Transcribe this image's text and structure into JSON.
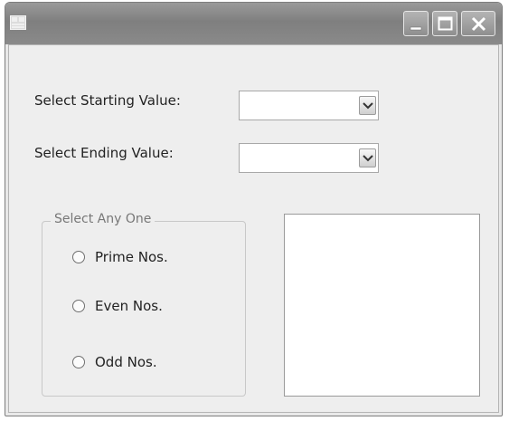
{
  "window": {
    "icon": "form-app-icon",
    "controls": [
      "minimize-icon",
      "maximize-icon",
      "close-icon"
    ]
  },
  "form": {
    "start_label": "Select Starting Value:",
    "start_value": "",
    "end_label": "Select Ending Value:",
    "end_value": "",
    "group": {
      "title": "Select Any One",
      "options": [
        "Prime Nos.",
        "Even Nos.",
        "Odd Nos."
      ]
    },
    "result_list": []
  }
}
